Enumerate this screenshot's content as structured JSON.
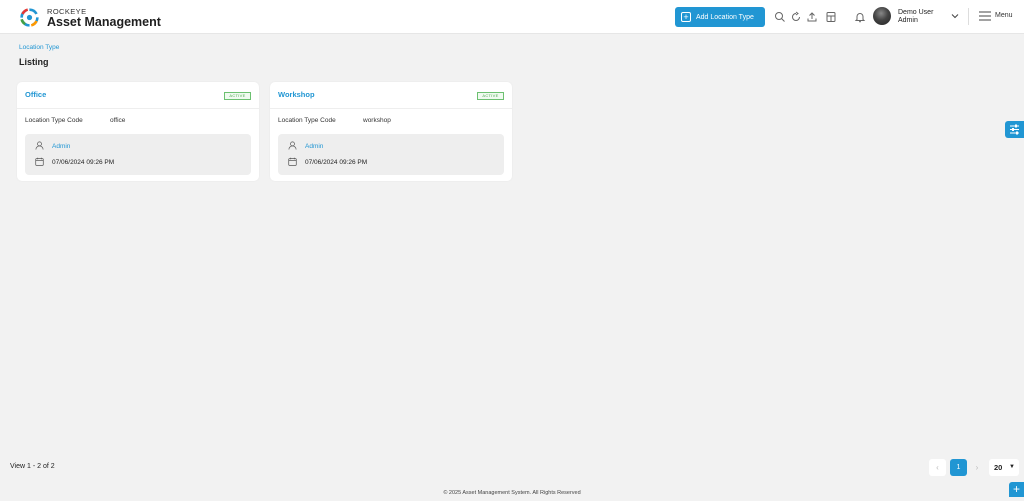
{
  "header": {
    "brand_top": "ROCKEYE",
    "brand_main": "Asset Management",
    "add_button_label": "Add Location Type",
    "user_name": "Demo User",
    "user_role": "Admin",
    "menu_label": "Menu"
  },
  "breadcrumb": "Location Type",
  "page_title": "Listing",
  "cards": [
    {
      "title": "Office",
      "status": "ACTIVE",
      "code_label": "Location Type Code",
      "code_value": "office",
      "created_by": "Admin",
      "created_at": "07/06/2024 09:26 PM"
    },
    {
      "title": "Workshop",
      "status": "ACTIVE",
      "code_label": "Location Type Code",
      "code_value": "workshop",
      "created_by": "Admin",
      "created_at": "07/06/2024 09:26 PM"
    }
  ],
  "pagination": {
    "view_count": "View 1 - 2 of 2",
    "current_page": "1",
    "page_size": "20"
  },
  "footer": "© 2025 Asset Management System. All Rights Reserved",
  "colors": {
    "accent": "#2196d3",
    "active_green": "#4ca94f"
  }
}
